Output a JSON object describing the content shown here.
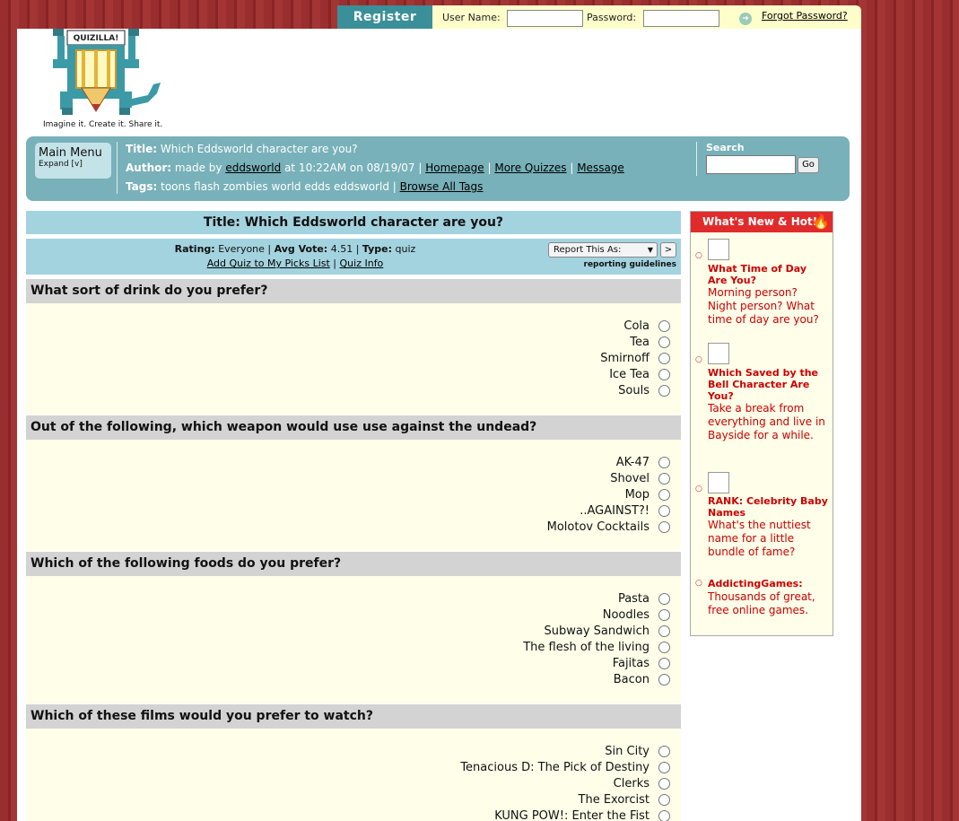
{
  "login": {
    "register_label": "Register",
    "username_label": "User Name:",
    "password_label": "Password:",
    "forgot_label": "Forgot Password?"
  },
  "brand": {
    "logo_text": "QUIZILLA!",
    "tagline": "Imagine it. Create it. Share it."
  },
  "infobar": {
    "main_menu": "Main Menu",
    "expand": "Expand [v]",
    "title_label": "Title:",
    "title_value": "Which Eddsworld character are you?",
    "author_label": "Author:",
    "author_prefix": "made by",
    "author_name": "eddsworld",
    "author_time": "at 10:22AM on 08/19/07 |",
    "homepage": "Homepage",
    "more_quizzes": "More Quizzes",
    "message": "Message",
    "tags_label": "Tags:",
    "tags_value": "toons flash zombies world edds eddsworld |",
    "browse_tags": "Browse All Tags",
    "search_label": "Search",
    "search_go": "Go"
  },
  "quiz": {
    "title": "Title: Which Eddsworld character are you?",
    "rating_label": "Rating:",
    "rating_value": "Everyone",
    "avgvote_label": "Avg Vote:",
    "avgvote_value": "4.51",
    "type_label": "Type:",
    "type_value": "quiz",
    "add_picks": "Add Quiz to My Picks List",
    "quiz_info": "Quiz Info",
    "report_label": "Report This As:",
    "report_go": ">",
    "guidelines": "reporting guidelines"
  },
  "questions": [
    {
      "q": "What sort of drink do you prefer?",
      "options": [
        "Cola",
        "Tea",
        "Smirnoff",
        "Ice Tea",
        "Souls"
      ]
    },
    {
      "q": "Out of the following, which weapon would use use against the undead?",
      "options": [
        "AK-47",
        "Shovel",
        "Mop",
        "..AGAINST?!",
        "Molotov Cocktails"
      ]
    },
    {
      "q": "Which of the following foods do you prefer?",
      "options": [
        "Pasta",
        "Noodles",
        "Subway Sandwich",
        "The flesh of the living",
        "Fajitas",
        "Bacon"
      ]
    },
    {
      "q": "Which of these films would you prefer to watch?",
      "options": [
        "Sin City",
        "Tenacious D: The Pick of Destiny",
        "Clerks",
        "The Exorcist",
        "KUNG POW!: Enter the Fist"
      ]
    }
  ],
  "sidebar": {
    "header": "What's New & Hot!",
    "items": [
      {
        "title": "What Time of Day Are You?",
        "desc": "Morning person? Night person? What time of day are you?"
      },
      {
        "title": "Which Saved by the Bell Character Are You?",
        "desc": "Take a break from everything and live in Bayside for a while."
      },
      {
        "title": "RANK: Celebrity Baby Names",
        "desc": "What's the nuttiest name for a little bundle of fame?"
      },
      {
        "title": "AddictingGames:",
        "desc": "Thousands of great, free online games."
      }
    ]
  },
  "colors": {
    "background": "#9a2e2e",
    "infobar": "#78b1b9",
    "titlebar": "#a3d3df",
    "hot_header": "#e12b2b",
    "link_red": "#cc0000"
  }
}
